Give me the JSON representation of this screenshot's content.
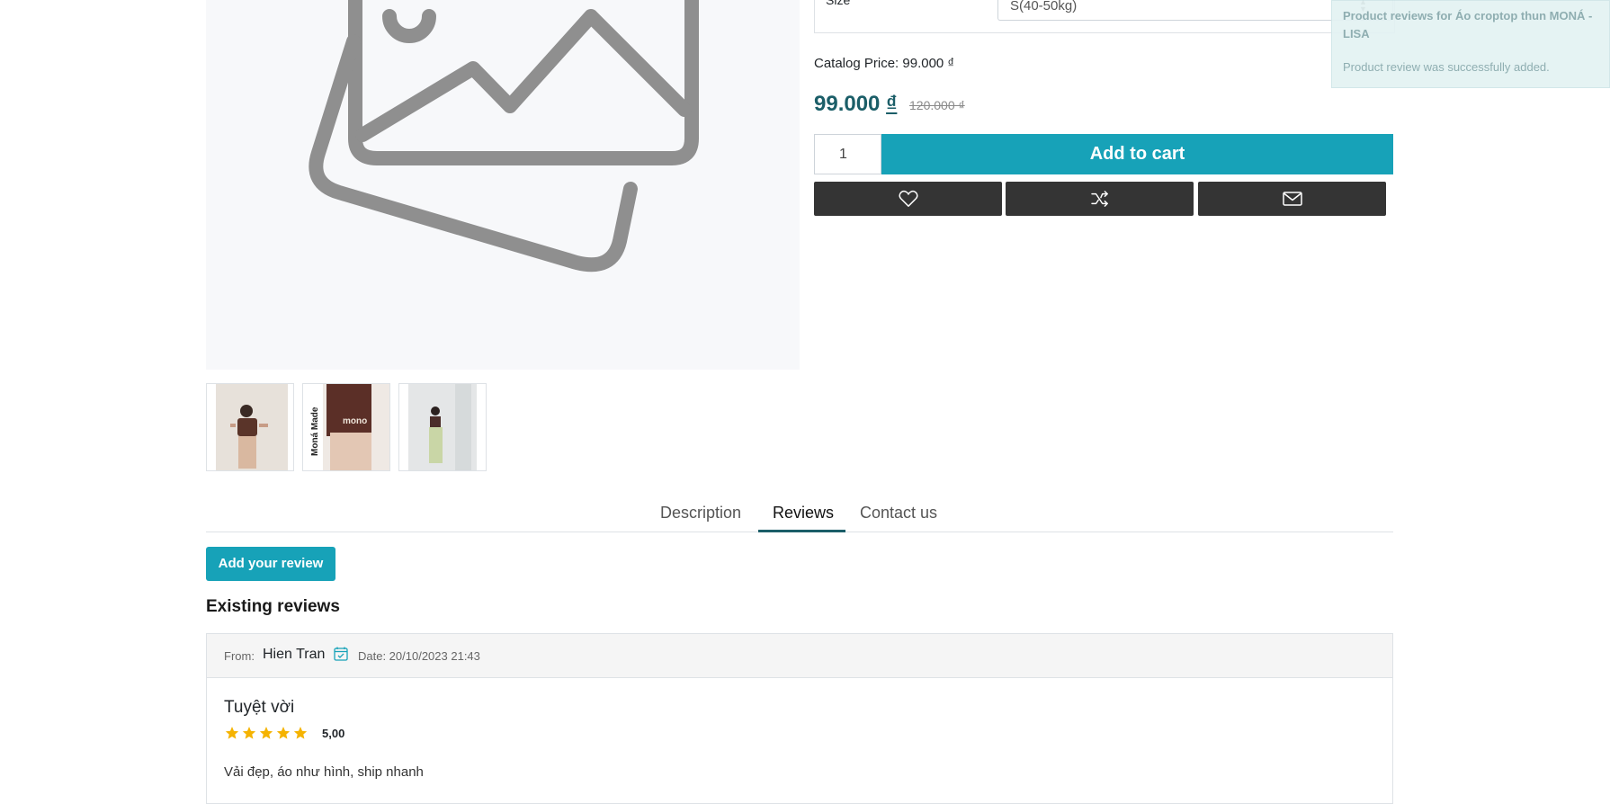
{
  "product": {
    "size_label": "Size",
    "size_value": "S(40-50kg)",
    "catalog_price": "Catalog Price: 99.000 ₫",
    "price_amount": "99.000",
    "price_currency": "₫",
    "old_price": "120.000 ₫",
    "quantity": "1",
    "add_to_cart": "Add to cart",
    "thumbnail_text": "Moná Made"
  },
  "actions": {
    "wishlist_icon": "heart-icon",
    "compare_icon": "shuffle-icon",
    "email_icon": "envelope-icon"
  },
  "toast": {
    "title": "Product reviews for Áo croptop thun MONÁ - LISA",
    "message": "Product review was successfully added."
  },
  "tabs": [
    {
      "label": "Description",
      "active": false
    },
    {
      "label": "Reviews",
      "active": true
    },
    {
      "label": "Contact us",
      "active": false
    }
  ],
  "reviews": {
    "add_button": "Add your review",
    "heading": "Existing reviews",
    "items": [
      {
        "from_label": "From:",
        "author": "Hien Tran",
        "date": "Date: 20/10/2023 21:43",
        "title": "Tuyệt vời",
        "rating": "5,00",
        "stars": 5,
        "text": "Vải đẹp, áo như hình, ship nhanh"
      }
    ]
  },
  "colors": {
    "accent": "#17a2b8",
    "price": "#1b5e68",
    "dark_button": "#343434",
    "star": "#f5b301"
  }
}
